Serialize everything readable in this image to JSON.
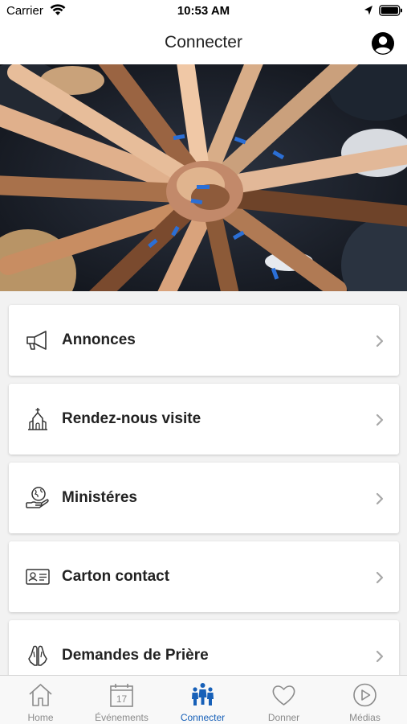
{
  "status_bar": {
    "carrier": "Carrier",
    "time": "10:53 AM"
  },
  "nav": {
    "title": "Connecter"
  },
  "menu": {
    "items": [
      {
        "label": "Annonces",
        "icon": "megaphone-icon"
      },
      {
        "label": "Rendez-nous visite",
        "icon": "church-icon"
      },
      {
        "label": "Ministéres",
        "icon": "globe-hand-icon"
      },
      {
        "label": "Carton contact",
        "icon": "contact-card-icon"
      },
      {
        "label": "Demandes de Prière",
        "icon": "praying-hands-icon"
      }
    ]
  },
  "tabs": [
    {
      "label": "Home",
      "icon": "home-icon",
      "active": false
    },
    {
      "label": "Événements",
      "icon": "calendar-icon",
      "calendar_day": "17",
      "active": false
    },
    {
      "label": "Connecter",
      "icon": "people-icon",
      "active": true
    },
    {
      "label": "Donner",
      "icon": "heart-icon",
      "active": false
    },
    {
      "label": "Médias",
      "icon": "play-icon",
      "active": false
    }
  ],
  "colors": {
    "accent": "#1760b8",
    "inactive": "#8a8a8a",
    "wristband": "#2b6fd6"
  }
}
